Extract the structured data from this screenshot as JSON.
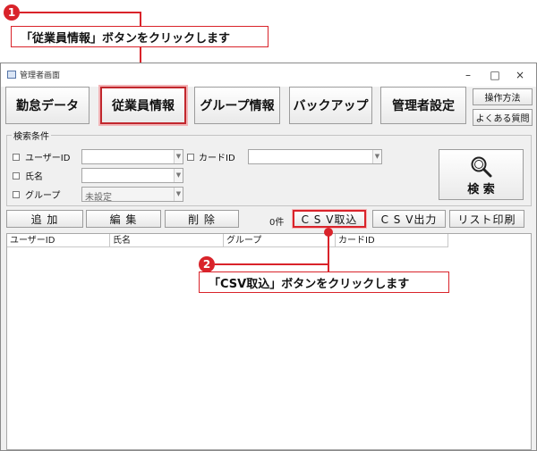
{
  "callouts": {
    "one": {
      "number": "1",
      "text": "「従業員情報」ボタンをクリックします"
    },
    "two": {
      "number": "2",
      "text": "「CSV取込」ボタンをクリックします"
    }
  },
  "window": {
    "title": "管理者画面",
    "controls": {
      "minimize": "–",
      "maximize": "□",
      "close": "×"
    }
  },
  "nav": {
    "attendance": "勤怠データ",
    "employee": "従業員情報",
    "group": "グループ情報",
    "backup": "バックアップ",
    "admin_settings": "管理者設定",
    "manual": "操作方法",
    "faq": "よくある質問"
  },
  "search": {
    "legend": "検索条件",
    "user_id_label": "ユーザーID",
    "card_id_label": "カードID",
    "name_label": "氏名",
    "group_label": "グループ",
    "group_value": "未設定",
    "button_label": "検 索",
    "icon": "magnifier-icon"
  },
  "actions": {
    "add": "追 加",
    "edit": "編 集",
    "delete": "削 除",
    "count": "0件",
    "csv_import": "C S V取込",
    "csv_export": "C S V出力",
    "print_list": "リスト印刷"
  },
  "table": {
    "columns": [
      "ユーザーID",
      "氏名",
      "グループ",
      "カードID"
    ]
  },
  "colors": {
    "accent": "#d9232a",
    "window_bg": "#f0f0f0"
  }
}
